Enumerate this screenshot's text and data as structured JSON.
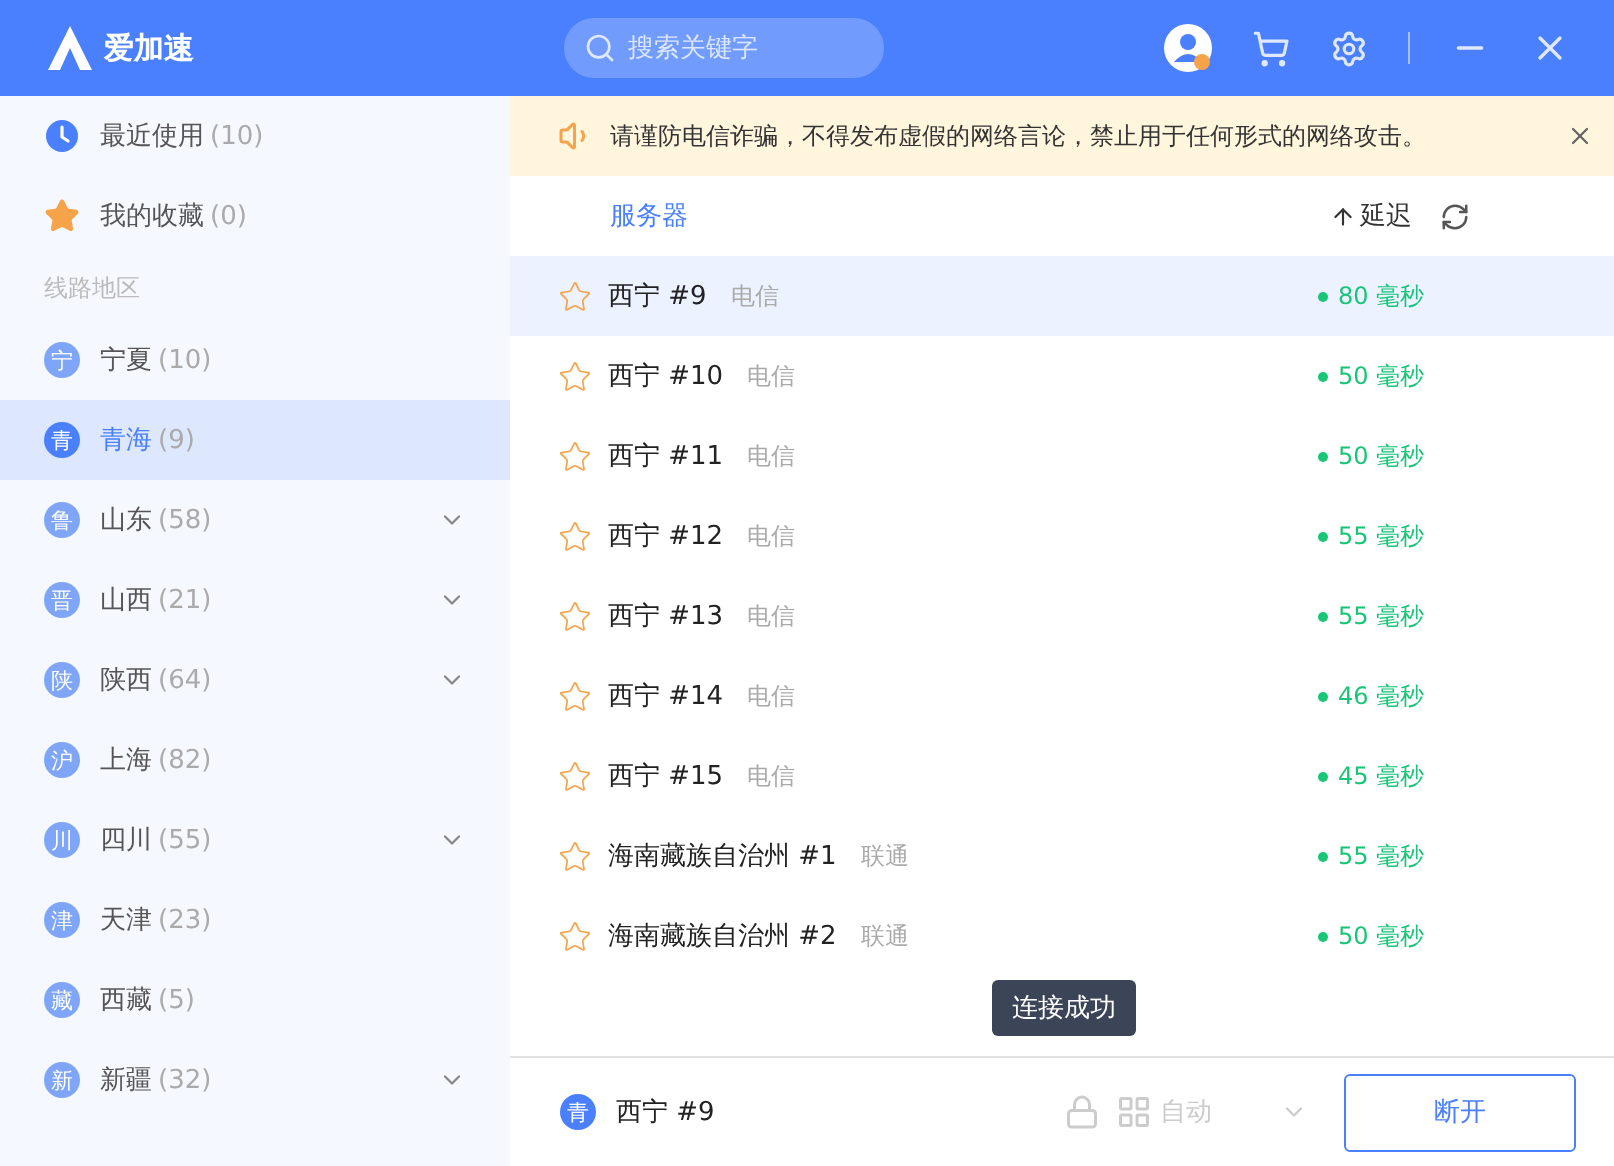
{
  "app": {
    "title": "爱加速"
  },
  "search": {
    "placeholder": "搜索关键字"
  },
  "sidebar": {
    "shortcuts": [
      {
        "kind": "recent",
        "label": "最近使用",
        "count": "(10)"
      },
      {
        "kind": "favorites",
        "label": "我的收藏",
        "count": "(0)"
      }
    ],
    "section_label": "线路地区",
    "regions": [
      {
        "badge": "宁",
        "name": "宁夏",
        "count": "(10)",
        "expandable": false,
        "selected": false
      },
      {
        "badge": "青",
        "name": "青海",
        "count": "(9)",
        "expandable": false,
        "selected": true
      },
      {
        "badge": "鲁",
        "name": "山东",
        "count": "(58)",
        "expandable": true,
        "selected": false
      },
      {
        "badge": "晋",
        "name": "山西",
        "count": "(21)",
        "expandable": true,
        "selected": false
      },
      {
        "badge": "陕",
        "name": "陕西",
        "count": "(64)",
        "expandable": true,
        "selected": false
      },
      {
        "badge": "沪",
        "name": "上海",
        "count": "(82)",
        "expandable": false,
        "selected": false
      },
      {
        "badge": "川",
        "name": "四川",
        "count": "(55)",
        "expandable": true,
        "selected": false
      },
      {
        "badge": "津",
        "name": "天津",
        "count": "(23)",
        "expandable": false,
        "selected": false
      },
      {
        "badge": "藏",
        "name": "西藏",
        "count": "(5)",
        "expandable": false,
        "selected": false
      },
      {
        "badge": "新",
        "name": "新疆",
        "count": "(32)",
        "expandable": true,
        "selected": false
      }
    ]
  },
  "notice": {
    "text": "请谨防电信诈骗，不得发布虚假的网络言论，禁止用于任何形式的网络攻击。"
  },
  "table": {
    "columns": [
      "服务器",
      "延迟"
    ],
    "rows": [
      {
        "favorite": false,
        "name": "西宁 #9",
        "isp": "电信",
        "latency": "80 毫秒",
        "selected": true
      },
      {
        "favorite": false,
        "name": "西宁 #10",
        "isp": "电信",
        "latency": "50 毫秒",
        "selected": false
      },
      {
        "favorite": false,
        "name": "西宁 #11",
        "isp": "电信",
        "latency": "50 毫秒",
        "selected": false
      },
      {
        "favorite": false,
        "name": "西宁 #12",
        "isp": "电信",
        "latency": "55 毫秒",
        "selected": false
      },
      {
        "favorite": false,
        "name": "西宁 #13",
        "isp": "电信",
        "latency": "55 毫秒",
        "selected": false
      },
      {
        "favorite": false,
        "name": "西宁 #14",
        "isp": "电信",
        "latency": "46 毫秒",
        "selected": false
      },
      {
        "favorite": false,
        "name": "西宁 #15",
        "isp": "电信",
        "latency": "45 毫秒",
        "selected": false
      },
      {
        "favorite": false,
        "name": "海南藏族自治州 #1",
        "isp": "联通",
        "latency": "55 毫秒",
        "selected": false
      },
      {
        "favorite": false,
        "name": "海南藏族自治州 #2",
        "isp": "联通",
        "latency": "50 毫秒",
        "selected": false
      }
    ]
  },
  "toast": {
    "text": "连接成功"
  },
  "footer": {
    "badge": "青",
    "server": "西宁 #9",
    "mode": "自动",
    "mode_disabled": true,
    "button": "断开"
  }
}
